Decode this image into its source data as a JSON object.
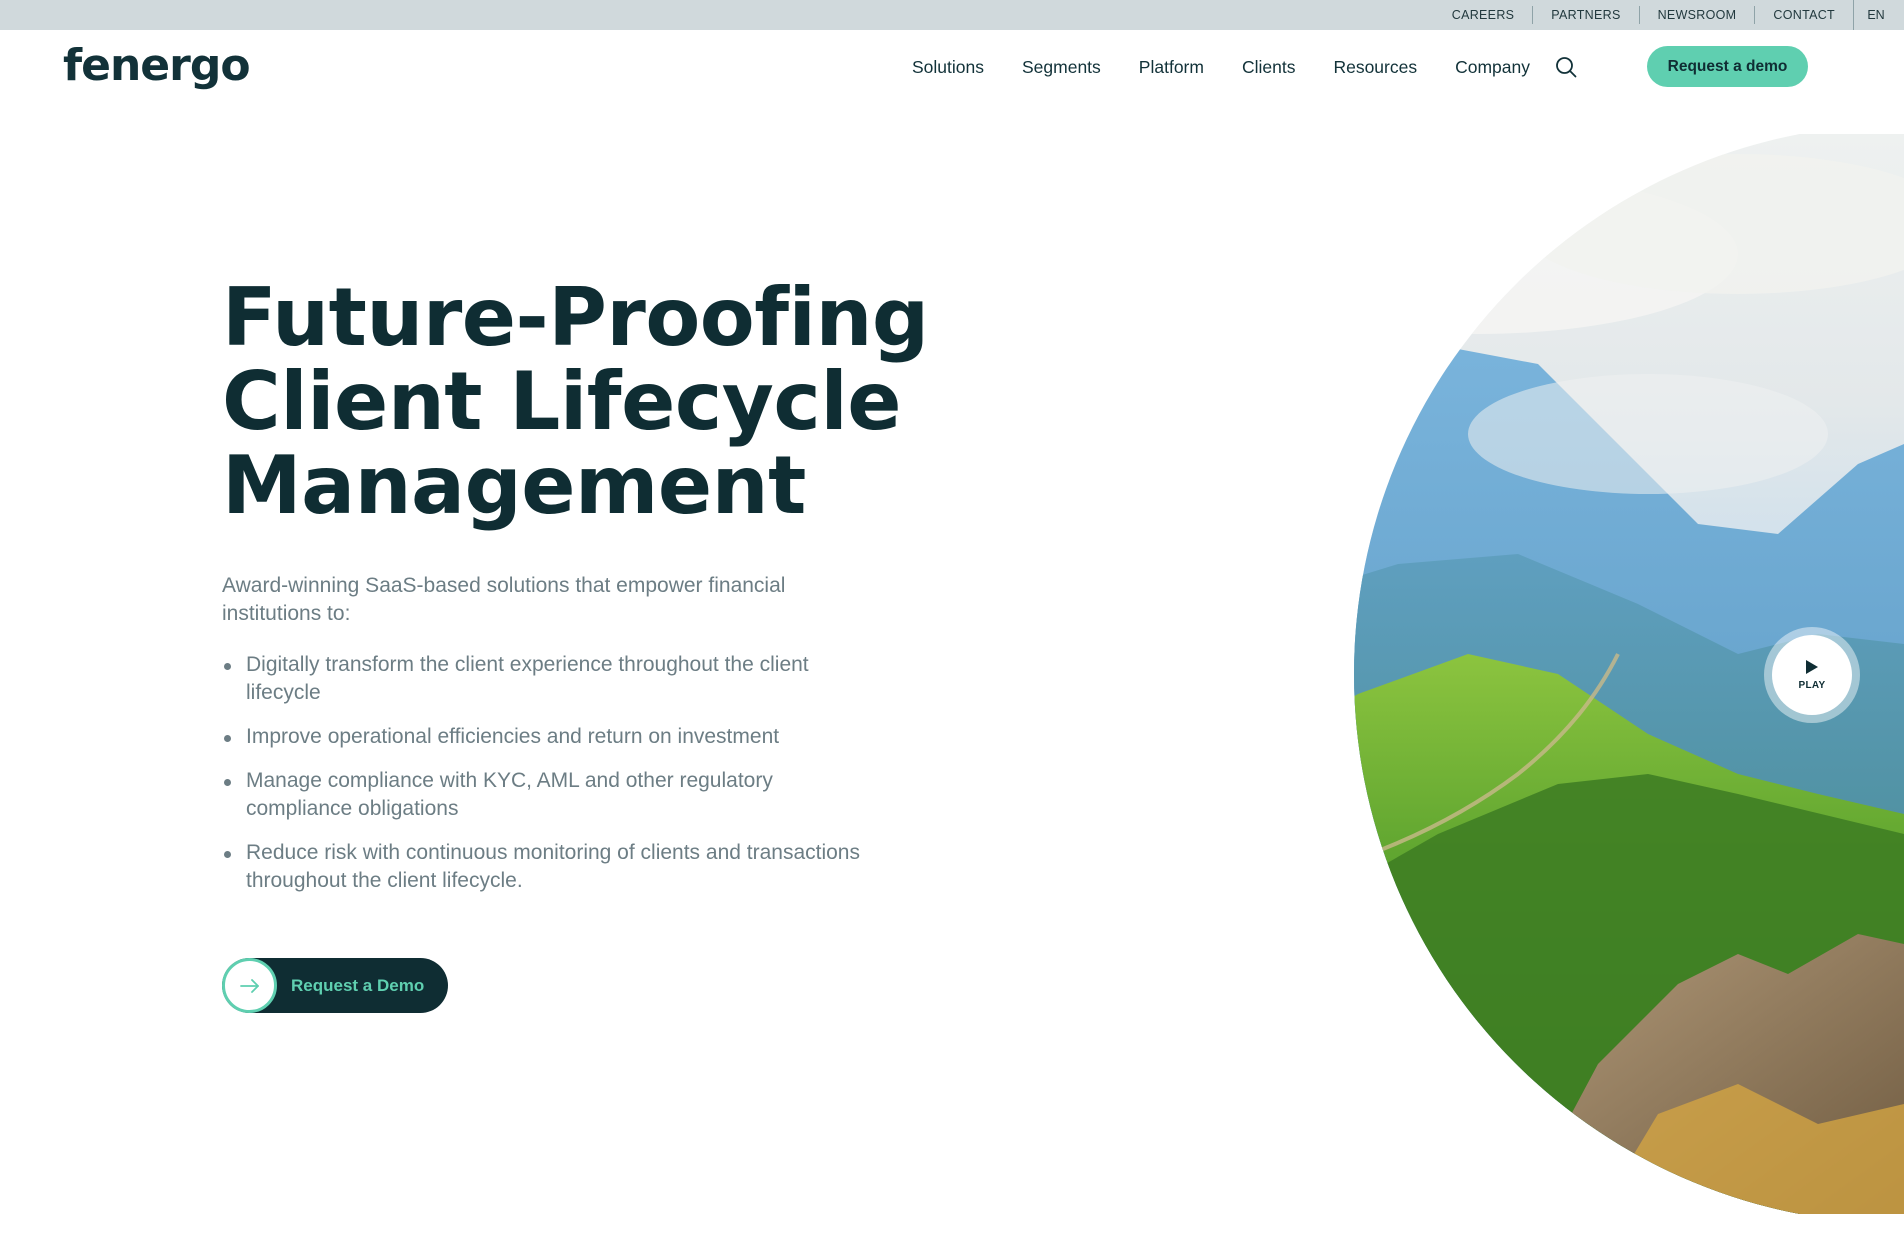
{
  "utility_bar": {
    "links": [
      "CAREERS",
      "PARTNERS",
      "NEWSROOM",
      "CONTACT"
    ],
    "language": "EN"
  },
  "header": {
    "logo_text": "fenergo",
    "nav": [
      "Solutions",
      "Segments",
      "Platform",
      "Clients",
      "Resources",
      "Company"
    ],
    "search_icon": "search-icon",
    "cta_label": "Request a demo"
  },
  "hero": {
    "title_lines": [
      "Future-Proofing",
      "Client Lifecycle",
      "Management"
    ],
    "intro": "Award-winning SaaS-based solutions that empower financial institutions to:",
    "bullets": [
      "Digitally transform the client experience throughout the client lifecycle",
      "Improve operational efficiencies and return on investment",
      "Manage compliance with KYC, AML and other regulatory compliance obligations",
      "Reduce risk with continuous monitoring of clients and transactions throughout the client lifecycle."
    ],
    "cta_label": "Request a Demo",
    "cta_icon": "arrow-right-icon",
    "video": {
      "play_label": "PLAY",
      "play_icon": "play-icon"
    }
  },
  "colors": {
    "accent": "#5fcfb0",
    "dark": "#0f2d33",
    "utility_bar": "#d0d9dc",
    "body_text": "#6c7d84"
  }
}
